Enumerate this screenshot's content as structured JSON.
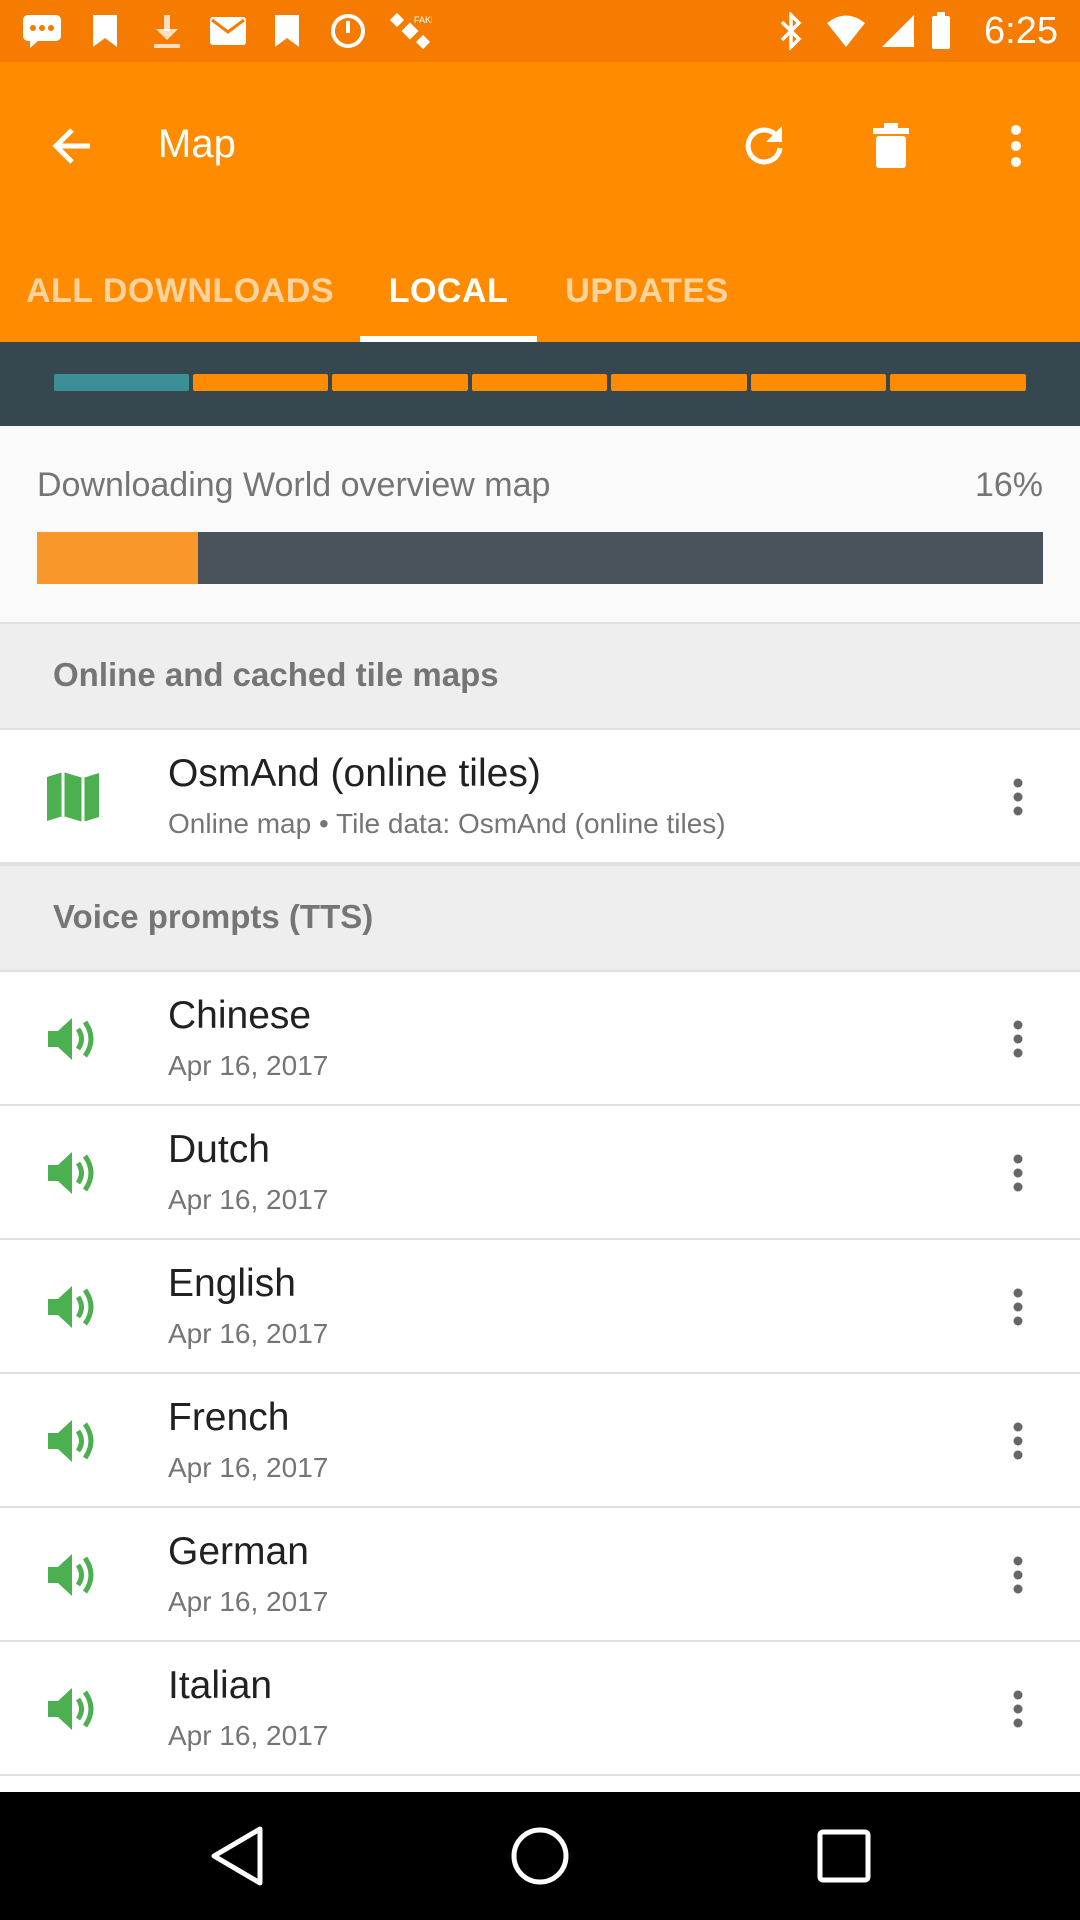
{
  "status_bar": {
    "time": "6:25",
    "icons": [
      "message-icon",
      "bookmark-icon",
      "download-icon",
      "email-icon",
      "bookmark-icon",
      "alarm-icon",
      "satellite-icon",
      "bluetooth-icon",
      "wifi-icon",
      "signal-icon",
      "battery-icon"
    ]
  },
  "app_bar": {
    "title": "Map",
    "actions": [
      "refresh-icon",
      "delete-icon",
      "more-vert-icon"
    ]
  },
  "tabs": [
    {
      "label": "ALL DOWNLOADS",
      "active": false
    },
    {
      "label": "LOCAL",
      "active": true
    },
    {
      "label": "UPDATES",
      "active": false
    }
  ],
  "storage": {
    "segments": 7,
    "used_fraction": 0.15
  },
  "download": {
    "label": "Downloading World overview map",
    "percent_text": "16%",
    "progress": 0.16
  },
  "sections": [
    {
      "header": "Online and cached tile maps",
      "items": [
        {
          "title": "OsmAnd (online tiles)",
          "subtitle": "Online map • Tile data: OsmAnd (online tiles)",
          "icon": "map-icon"
        }
      ]
    },
    {
      "header": "Voice prompts (TTS)",
      "items": [
        {
          "title": "Chinese",
          "subtitle": "Apr 16, 2017",
          "icon": "volume-icon"
        },
        {
          "title": "Dutch",
          "subtitle": "Apr 16, 2017",
          "icon": "volume-icon"
        },
        {
          "title": "English",
          "subtitle": "Apr 16, 2017",
          "icon": "volume-icon"
        },
        {
          "title": "French",
          "subtitle": "Apr 16, 2017",
          "icon": "volume-icon"
        },
        {
          "title": "German",
          "subtitle": "Apr 16, 2017",
          "icon": "volume-icon"
        },
        {
          "title": "Italian",
          "subtitle": "Apr 16, 2017",
          "icon": "volume-icon"
        }
      ]
    }
  ],
  "colors": {
    "accent": "#ff8c00",
    "status_bar": "#f57c00",
    "icon_green": "#4caf50",
    "progress_fill": "#f9972b",
    "progress_track": "#4a535a"
  },
  "nav_bar": [
    "back-nav-icon",
    "home-nav-icon",
    "recents-nav-icon"
  ]
}
